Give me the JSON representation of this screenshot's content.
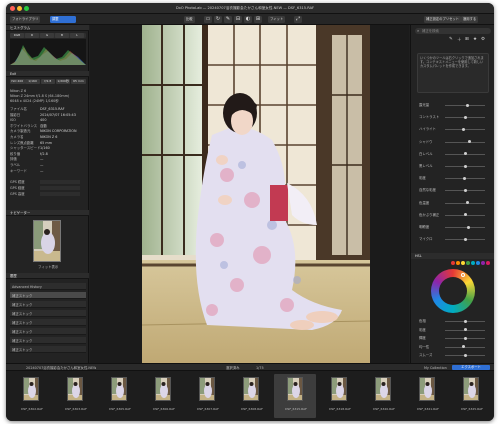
{
  "window": {
    "title": "DxO PhotoLab — 20240707浴衣撮影会たかさん和室女性.NEW — DSF_6315.RAF",
    "traffic_colors": [
      "#ff5f57",
      "#febc2e",
      "#28c840"
    ]
  },
  "toolbar": {
    "left_tab": "フォトライブラリ",
    "edit_tab": "調整",
    "compare_label": "比較",
    "export_label": "エクスポート",
    "fit_label": "フィット",
    "right_label": "補正設定のプリセット",
    "apply_label": "適用する"
  },
  "left_panel": {
    "histogram_header": "ヒストグラム",
    "histogram_chips": [
      "RGB",
      "R",
      "G",
      "B",
      "L"
    ],
    "exif_header": "Exif",
    "exif_chips": [
      "ISO 400",
      "1/160",
      "f/2.8",
      "1/200秒",
      "65 mm"
    ],
    "camera_info": [
      "Nikon Z 6",
      "Nikon Z 24mm f/1.8 S (64-180mm)",
      "6048 x 4024 (24MP) 1/160秒"
    ],
    "metadata": [
      {
        "k": "ファイル名",
        "v": "DSF_6315.RAF"
      },
      {
        "k": "撮影日",
        "v": "2024/07/07 16:05:43"
      },
      {
        "k": "ISO",
        "v": "400"
      },
      {
        "k": "ホワイトバランス",
        "v": "自動"
      },
      {
        "k": "カメラ製造元",
        "v": "NIKON CORPORATION"
      },
      {
        "k": "カメラ名",
        "v": "NIKON Z 6"
      },
      {
        "k": "レンズ焦点距離",
        "v": "65 mm"
      },
      {
        "k": "シャッタースピード",
        "v": "1/160"
      },
      {
        "k": "絞り値",
        "v": "f/2.8"
      },
      {
        "k": "評価",
        "v": "—"
      },
      {
        "k": "ラベル",
        "v": "—"
      },
      {
        "k": "キーワード",
        "v": "—"
      }
    ],
    "gps": [
      {
        "k": "GPS 緯度",
        "v": ""
      },
      {
        "k": "GPS 経度",
        "v": ""
      },
      {
        "k": "GPS 高度",
        "v": ""
      }
    ],
    "navigator_header": "ナビゲーター",
    "navigator_caption": "フィット表示",
    "history_header": "履歴",
    "history_items": [
      "Advanced History",
      "補正ストック",
      "補正ストック",
      "補正ストック",
      "補正ストック",
      "補正ストック",
      "補正ストック",
      "補正ストック"
    ]
  },
  "right_panel": {
    "search_placeholder": "補正を検索",
    "info_text": "いくつかのツールは右クリックで追加されます。コンテキストメニューを使用して新しいカスタムパレットを作成できます。",
    "sections": [
      "ライト",
      "カラー",
      "ディテール",
      "ジオメトリ",
      "ローカル補正"
    ],
    "sliders": [
      {
        "label": "露光量",
        "value": 0.55
      },
      {
        "label": "コントラスト",
        "value": 0.5
      },
      {
        "label": "ハイライト",
        "value": 0.45
      },
      {
        "label": "シャドウ",
        "value": 0.6
      },
      {
        "label": "白レベル",
        "value": 0.5
      },
      {
        "label": "黒レベル",
        "value": 0.52
      },
      {
        "label": "彩度",
        "value": 0.48
      },
      {
        "label": "自然な彩度",
        "value": 0.5
      },
      {
        "label": "色温度",
        "value": 0.56
      },
      {
        "label": "色かぶり補正",
        "value": 0.5
      },
      {
        "label": "明瞭度",
        "value": 0.58
      },
      {
        "label": "マイクロ",
        "value": 0.5
      }
    ],
    "hsl_header": "HSL",
    "color_swatches": [
      "#e53935",
      "#fb8c00",
      "#fdd835",
      "#43a047",
      "#00acc1",
      "#1e88e5",
      "#8e24aa",
      "#d81b60"
    ],
    "lower_sliders": [
      {
        "label": "色相",
        "value": 0.5
      },
      {
        "label": "彩度",
        "value": 0.5
      },
      {
        "label": "輝度",
        "value": 0.5
      },
      {
        "label": "均一性",
        "value": 0.46
      },
      {
        "label": "スムーズ",
        "value": 0.5
      }
    ]
  },
  "filmstrip_bar": {
    "path": "20240707浴衣撮影会たかさん和室女性.NEW",
    "selection": "選択済み",
    "counter": "1/75",
    "collection_label": "My Collection",
    "export_label": "エクスポート"
  },
  "filmstrip": [
    {
      "name": "DSF_6302.RAF",
      "sel": false
    },
    {
      "name": "DSF_6303.RAF",
      "sel": false
    },
    {
      "name": "DSF_6305.RAF",
      "sel": false
    },
    {
      "name": "DSF_6306.RAF",
      "sel": false
    },
    {
      "name": "DSF_6307.RAF",
      "sel": false
    },
    {
      "name": "DSF_6308.RAF",
      "sel": false
    },
    {
      "name": "DSF_6315.RAF",
      "sel": true
    },
    {
      "name": "DSF_6318.RAF",
      "sel": false
    },
    {
      "name": "DSF_6320.RAF",
      "sel": false
    },
    {
      "name": "DSF_6321.RAF",
      "sel": false
    },
    {
      "name": "DSF_6325.RAF",
      "sel": false
    }
  ]
}
